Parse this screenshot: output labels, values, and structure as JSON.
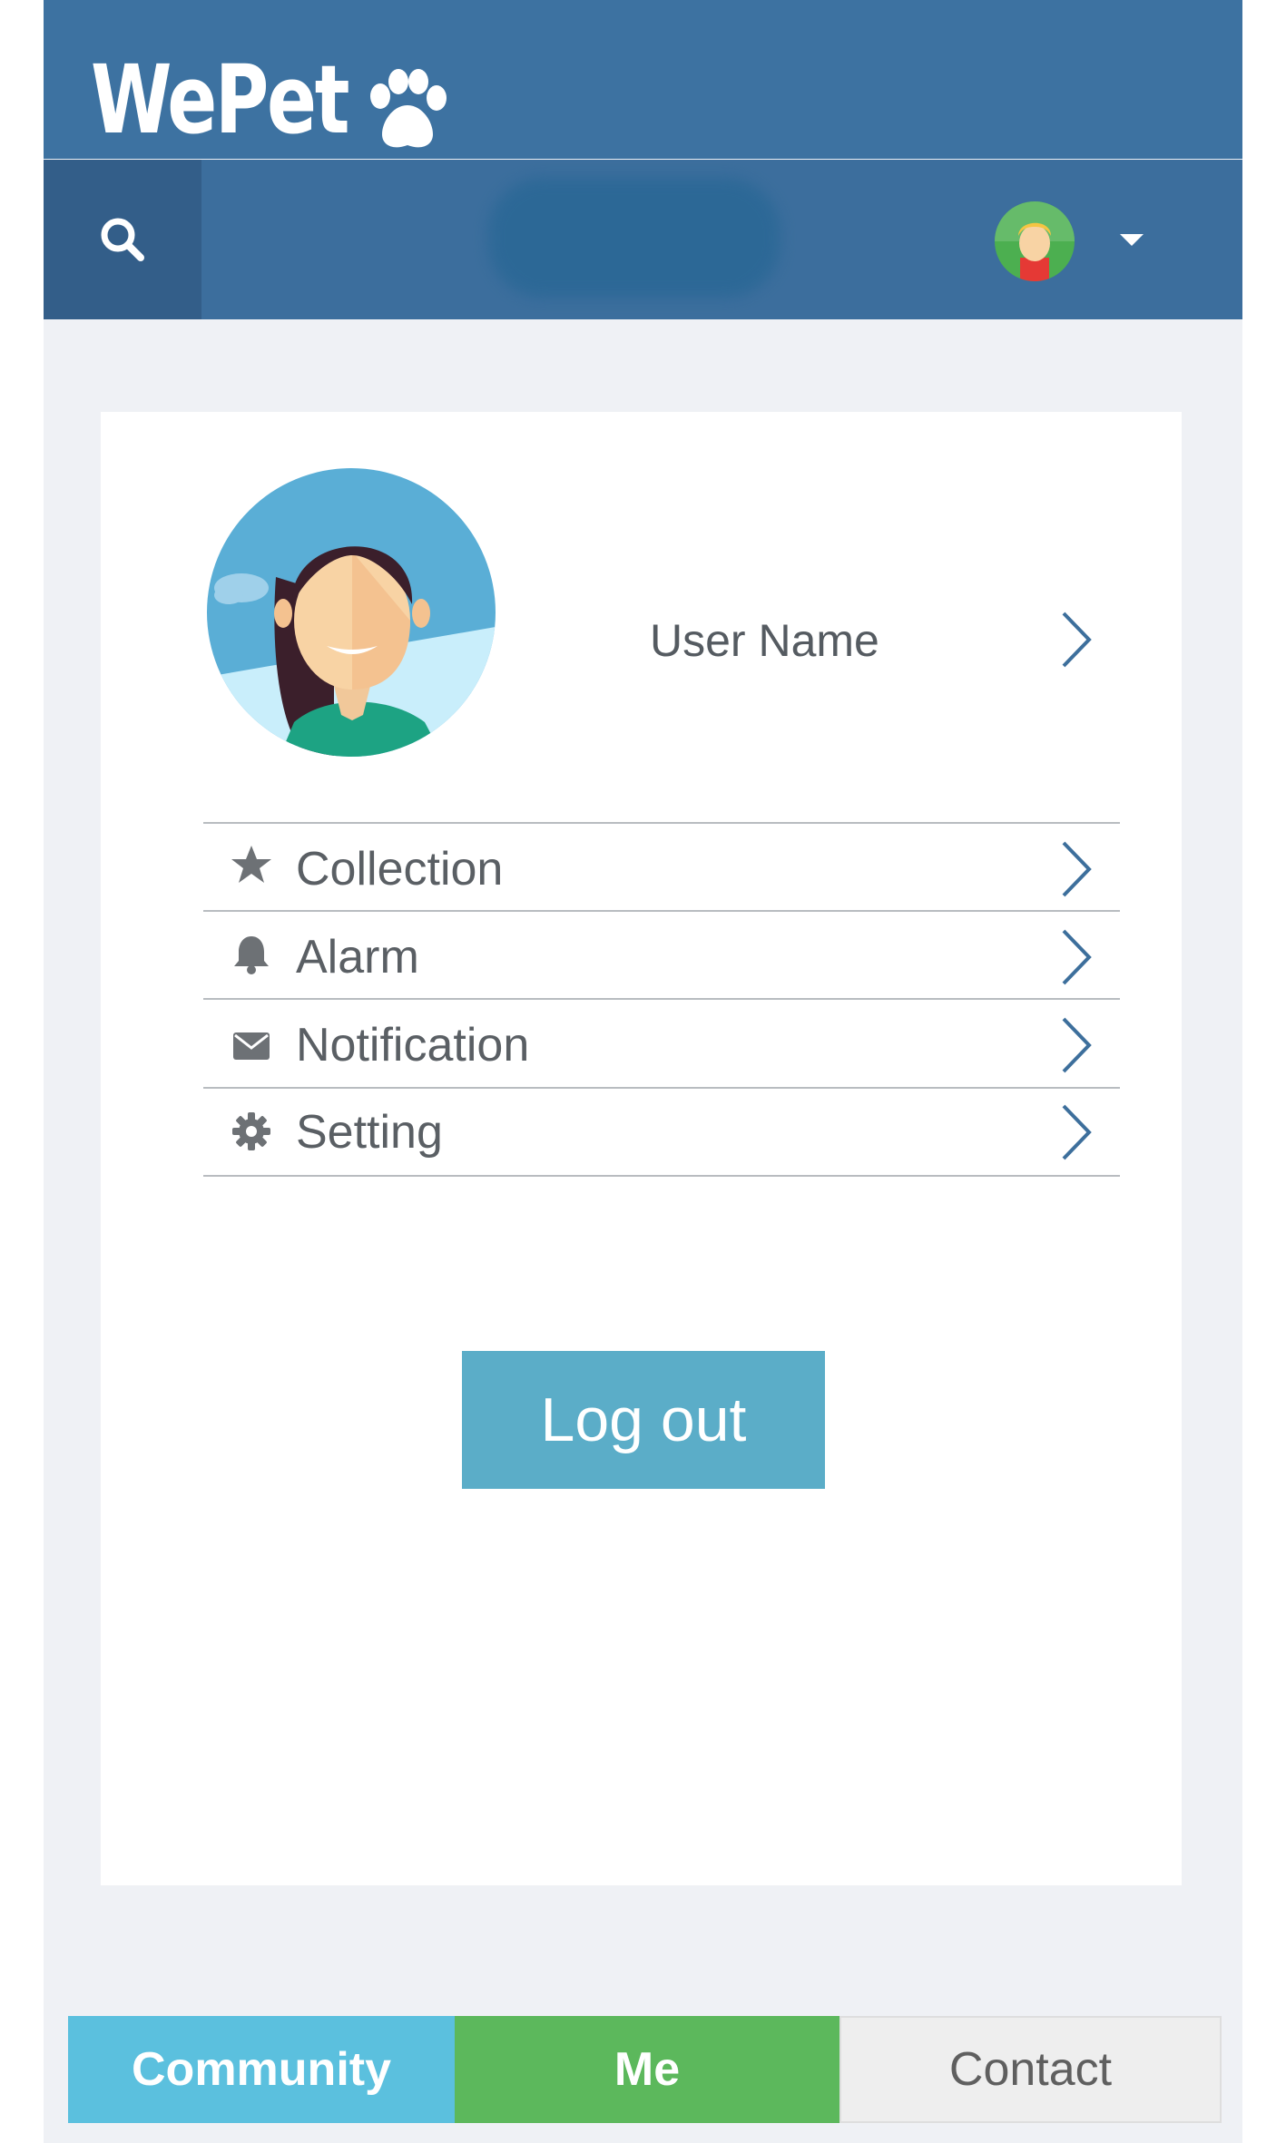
{
  "header": {
    "logo_text": "WePet",
    "logo_icon": "paw-icon",
    "search_icon": "search-icon",
    "avatar_icon": "user-avatar-icon",
    "dropdown_icon": "caret-down-icon"
  },
  "profile": {
    "user_name": "User Name",
    "avatar_icon": "woman-avatar-icon"
  },
  "menu": {
    "items": [
      {
        "label": "Collection",
        "icon": "star-icon"
      },
      {
        "label": "Alarm",
        "icon": "bell-icon"
      },
      {
        "label": "Notification",
        "icon": "envelope-icon"
      },
      {
        "label": "Setting",
        "icon": "gear-icon"
      }
    ]
  },
  "actions": {
    "logout_label": "Log out"
  },
  "tabs": [
    {
      "label": "Community",
      "active": false
    },
    {
      "label": "Me",
      "active": true
    },
    {
      "label": "Contact",
      "active": false
    }
  ],
  "colors": {
    "brand": "#3d72a1",
    "logout": "#5badc8",
    "community_tab": "#5bc0de",
    "me_tab": "#5cb85c",
    "contact_tab": "#eeeeee",
    "chevron": "#3d6f9c"
  }
}
